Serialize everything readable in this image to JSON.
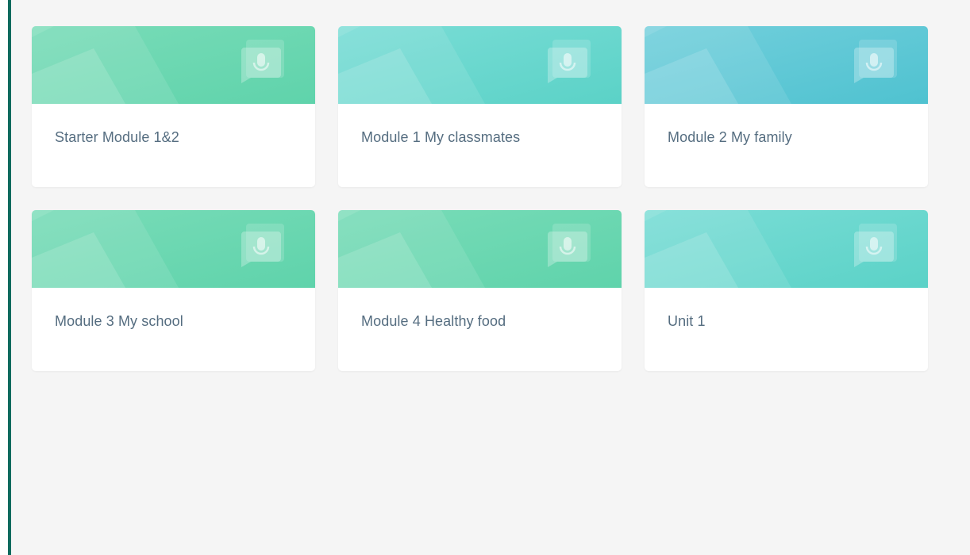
{
  "modules": [
    {
      "title": "Starter Module 1&2",
      "theme": "green"
    },
    {
      "title": "Module 1 My classmates",
      "theme": "teal"
    },
    {
      "title": "Module 2 My family",
      "theme": "blue"
    },
    {
      "title": "Module 3 My school",
      "theme": "green"
    },
    {
      "title": "Module 4 Healthy food",
      "theme": "green"
    },
    {
      "title": "Unit 1",
      "theme": "teal"
    }
  ],
  "themes": {
    "green": {
      "from": "#79dcb8",
      "to": "#5fd3ab"
    },
    "teal": {
      "from": "#7addd6",
      "to": "#5bd2c7"
    },
    "blue": {
      "from": "#72cfdc",
      "to": "#4fc2d0"
    }
  },
  "accent_border": "#0f6b5e",
  "icon": "microphone-chat-icon"
}
